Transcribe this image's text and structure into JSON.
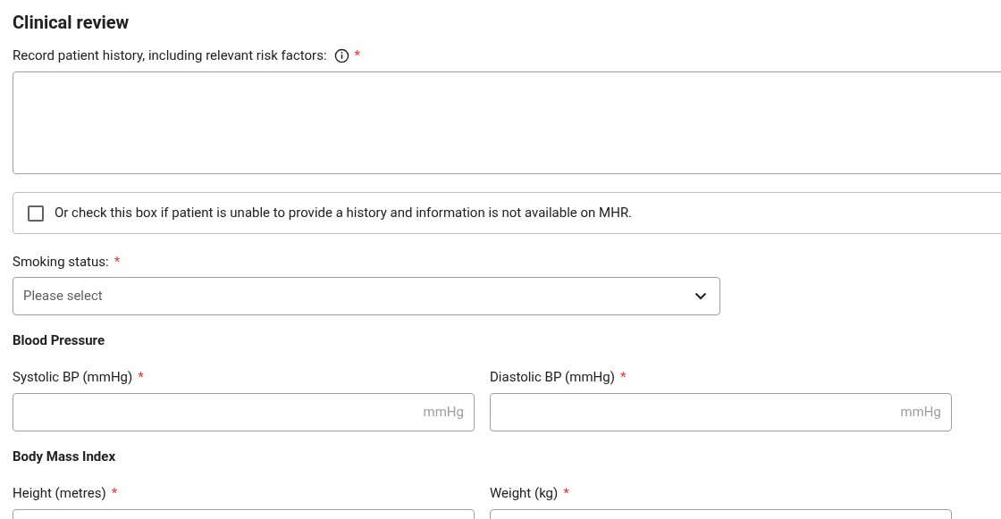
{
  "title": "Clinical review",
  "history": {
    "label": "Record patient history, including relevant risk factors:",
    "required_mark": "*",
    "info": true
  },
  "no_history_checkbox": {
    "label": "Or check this box if patient is unable to provide a history and information is not available on MHR.",
    "checked": false
  },
  "smoking": {
    "label": "Smoking status:",
    "required_mark": "*",
    "placeholder": "Please select"
  },
  "sections": [
    {
      "heading": "Blood Pressure",
      "fields": [
        {
          "label": "Systolic BP (mmHg)",
          "required_mark": "*",
          "unit": "mmHg"
        },
        {
          "label": "Diastolic BP (mmHg)",
          "required_mark": "*",
          "unit": "mmHg"
        }
      ]
    },
    {
      "heading": "Body Mass Index",
      "fields": [
        {
          "label": "Height (metres)",
          "required_mark": "*"
        },
        {
          "label": "Weight (kg)",
          "required_mark": "*"
        }
      ]
    }
  ]
}
